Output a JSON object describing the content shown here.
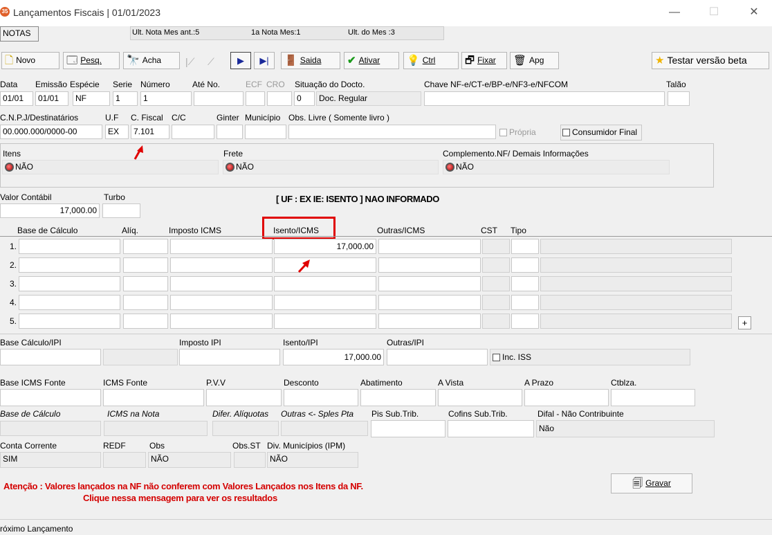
{
  "window": {
    "title": "Lançamentos Fiscais |  01/01/2023",
    "app_icon": "35",
    "minimize": "—",
    "maximize": "☐",
    "close": "✕"
  },
  "notas_bar": {
    "tab": "NOTAS",
    "ult_nota": "Ult. Nota Mes ant.:5",
    "primeira_nota": "1a Nota Mes:1",
    "ult_mes": "Ult. do Mes :3"
  },
  "toolbar": {
    "novo": "Novo",
    "pesq": "Pesq.",
    "acha": "Acha",
    "saida": "Saida",
    "ativar": "Ativar",
    "ctrl": "Ctrl",
    "fixar": "Fixar",
    "apg": "Apg",
    "testar": "Testar versão beta"
  },
  "header": {
    "labels": {
      "data": "Data",
      "emissao": "Emissão",
      "especie": "Espécie",
      "serie": "Serie",
      "numero": "Número",
      "ate_no": "Até No.",
      "ecf": "ECF",
      "cro": "CRO",
      "situacao": "Situação do Docto.",
      "chave": "Chave NF-e/CT-e/BP-e/NF3-e/NFCOM",
      "talao": "Talão"
    },
    "values": {
      "data": "01/01",
      "emissao": "01/01",
      "especie": "NF",
      "serie": "1",
      "numero": "1",
      "situacao_code": "0",
      "situacao_desc": "Doc. Regular"
    }
  },
  "dest": {
    "labels": {
      "cnpj": "C.N.P.J/Destinatários",
      "uf": "U.F",
      "cfiscal": "C. Fiscal",
      "cc": "C/C",
      "ginter": "Ginter",
      "municipio": "Município",
      "obs_livre": "Obs. Livre ( Somente livro )"
    },
    "values": {
      "cnpj": "00.000.000/0000-00",
      "uf": "EX",
      "cfiscal": "7.101"
    },
    "propria": "Própria",
    "consumidor_final": "Consumidor Final"
  },
  "info_panel": {
    "itens_label": "Itens",
    "itens_value": "NÃO",
    "frete_label": "Frete",
    "frete_value": "NÃO",
    "complemento_label": "Complemento.NF/ Demais Informações",
    "complemento_value": "NÃO"
  },
  "valores": {
    "valor_contabil_label": "Valor Contábil",
    "valor_contabil": "17,000.00",
    "turbo_label": "Turbo",
    "uf_msg": "[ UF : EX IE: ISENTO ] NAO INFORMADO"
  },
  "icms_grid": {
    "headers": [
      "Base de Cálculo",
      "Alíq.",
      "Imposto ICMS",
      "Isento/ICMS",
      "Outras/ICMS",
      "CST",
      "Tipo"
    ],
    "rows": [
      {
        "n": "1.",
        "isento": "17,000.00"
      },
      {
        "n": "2.",
        "isento": ""
      },
      {
        "n": "3.",
        "isento": ""
      },
      {
        "n": "4.",
        "isento": ""
      },
      {
        "n": "5.",
        "isento": ""
      }
    ],
    "add_button": "+"
  },
  "ipi": {
    "base_label": "Base Cálculo/IPI",
    "imposto_label": "Imposto IPI",
    "isento_label": "Isento/IPI",
    "isento_value": "17,000.00",
    "outras_label": "Outras/IPI",
    "inc_iss": "Inc. ISS"
  },
  "fonte": {
    "labels": [
      "Base ICMS Fonte",
      "ICMS Fonte",
      "P.V.V",
      "Desconto",
      "Abatimento",
      "A Vista",
      "A Prazo",
      "Ctblza."
    ]
  },
  "misc": {
    "base_calculo": "Base de Cálculo",
    "icms_nota": "ICMS na Nota",
    "difer_aliquotas": "Difer. Alíquotas",
    "outras_sples": "Outras <- Sples Pta",
    "pis_sub": "Pis Sub.Trib.",
    "cofins_sub": "Cofins Sub.Trib.",
    "difal_label": "Difal - Não Contribuinte",
    "difal_value": "Não"
  },
  "bottom": {
    "conta_corrente_label": "Conta Corrente",
    "conta_corrente": "SIM",
    "redf_label": "REDF",
    "obs_label": "Obs",
    "obs_value": "NÃO",
    "obs_st_label": "Obs.ST",
    "div_municipios_label": "Div. Municípios (IPM)",
    "div_municipios_value": "NÃO"
  },
  "warning": {
    "line1": "Atenção : Valores lançados na NF não conferem com Valores Lançados nos Itens da NF.",
    "line2": "Clique nessa mensagem para ver os resultados"
  },
  "gravar": "Gravar",
  "status_bar": "róximo  Lançamento",
  "colors": {
    "highlight": "#e00000",
    "warning_text": "#d40000"
  }
}
